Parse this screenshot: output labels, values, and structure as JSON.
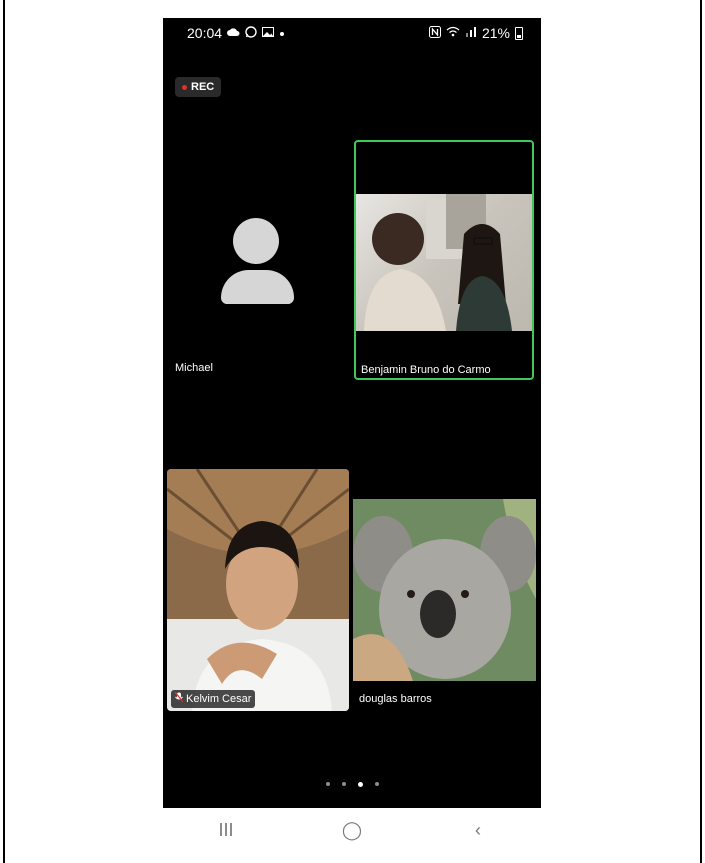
{
  "status_bar": {
    "time": "20:04",
    "left_icons": [
      "cloud-icon",
      "whatsapp-icon",
      "gallery-icon",
      "dot-icon"
    ],
    "right_icons": [
      "nfc-icon",
      "wifi-icon",
      "signal-icon"
    ],
    "battery": "21%"
  },
  "recording": {
    "label": "REC",
    "color": "#e0302a"
  },
  "participants": [
    {
      "name": "Michael",
      "video": false
    },
    {
      "name": "Benjamin Bruno do Carmo",
      "video": true,
      "active_speaker": true,
      "highlight_color": "#3fc85a"
    },
    {
      "name": "Kelvim Cesar",
      "video": true,
      "muted": true
    },
    {
      "name": "douglas barros",
      "video": true
    }
  ],
  "pagination": {
    "pages": 4,
    "current": 3
  },
  "nav": {
    "recent": "III",
    "home": "◯",
    "back": "‹"
  }
}
